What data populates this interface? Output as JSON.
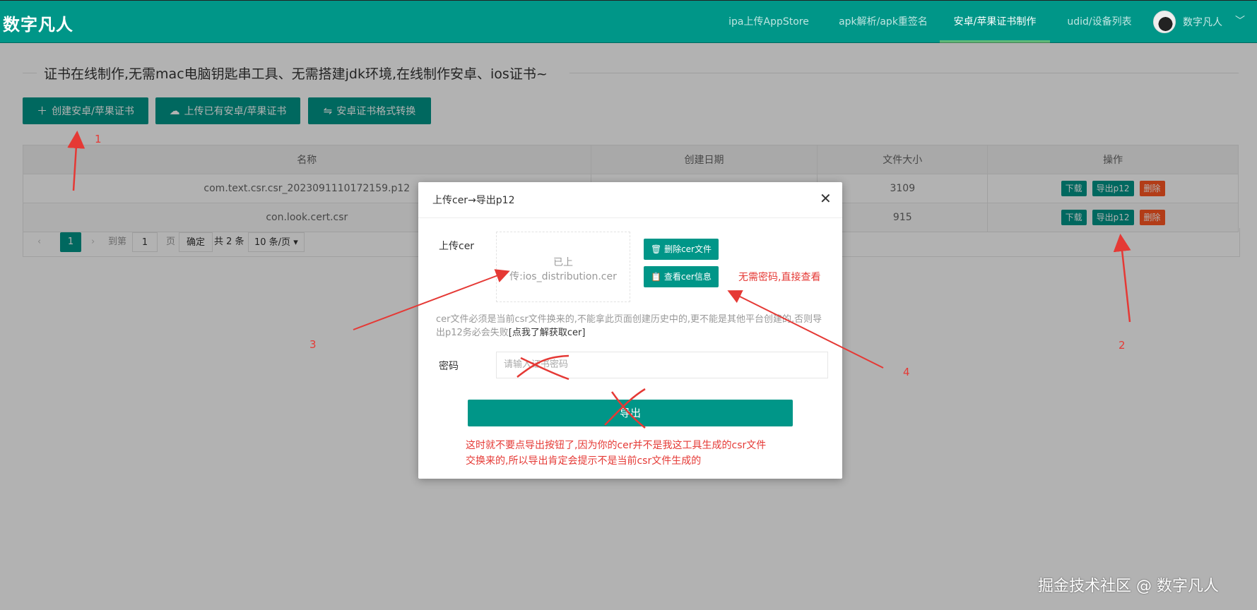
{
  "header": {
    "brand": "数字凡人",
    "nav": [
      {
        "label": "ipa上传AppStore"
      },
      {
        "label": "apk解析/apk重签名"
      },
      {
        "label": "安卓/苹果证书制作"
      },
      {
        "label": "udid/设备列表"
      }
    ],
    "user_name": "数字凡人",
    "chevron": "﹀"
  },
  "page": {
    "legend": "证书在线制作,无需mac电脑钥匙串工具、无需搭建jdk环境,在线制作安卓、ios证书~",
    "buttons": [
      {
        "icon": "＋",
        "label": "创建安卓/苹果证书"
      },
      {
        "icon": "☁",
        "label": "上传已有安卓/苹果证书"
      },
      {
        "icon": "⇋",
        "label": "安卓证书格式转换"
      }
    ]
  },
  "table": {
    "headers": [
      "名称",
      "创建日期",
      "文件大小",
      "操作"
    ],
    "rows": [
      {
        "name": "com.text.csr.csr_2023091110172159.p12",
        "date": "",
        "size": "3109"
      },
      {
        "name": "con.look.cert.csr",
        "date": "",
        "size": "915"
      }
    ],
    "actions": {
      "download": "下载",
      "export": "导出p12",
      "delete": "删除"
    }
  },
  "pager": {
    "prev": "‹",
    "current": "1",
    "next": "›",
    "goto_label": "到第",
    "goto_value": "1",
    "page_label": "页",
    "confirm": "确定",
    "total": "共 2 条",
    "per_page": "10 条/页"
  },
  "modal": {
    "title": "上传cer→导出p12",
    "close": "✕",
    "upload_label": "上传cer",
    "upload_status_1": "已上",
    "upload_status_2": "传:ios_distribution.cer",
    "delete_cer": "删除cer文件",
    "view_cer": "查看cer信息",
    "note": "cer文件必须是当前csr文件换来的,不能拿此页面创建历史中的,更不能是其他平台创建的,否则导出p12务必会失败",
    "note_link": "[点我了解获取cer]",
    "password_label": "密码",
    "password_placeholder": "请输入证书密码",
    "export_label": "导出"
  },
  "annotations": {
    "n1": "1",
    "n2": "2",
    "n3": "3",
    "n4": "4",
    "no_password": "无需密码,直接查看",
    "explain_1": "这时就不要点导出按钮了,因为你的cer并不是我这工具生成的csr文件",
    "explain_2": "交换来的,所以导出肯定会提示不是当前csr文件生成的"
  },
  "watermark": "掘金技术社区 @ 数字凡人",
  "colors": {
    "primary": "#009688",
    "danger": "#ff5722",
    "annotation": "#e53935"
  }
}
